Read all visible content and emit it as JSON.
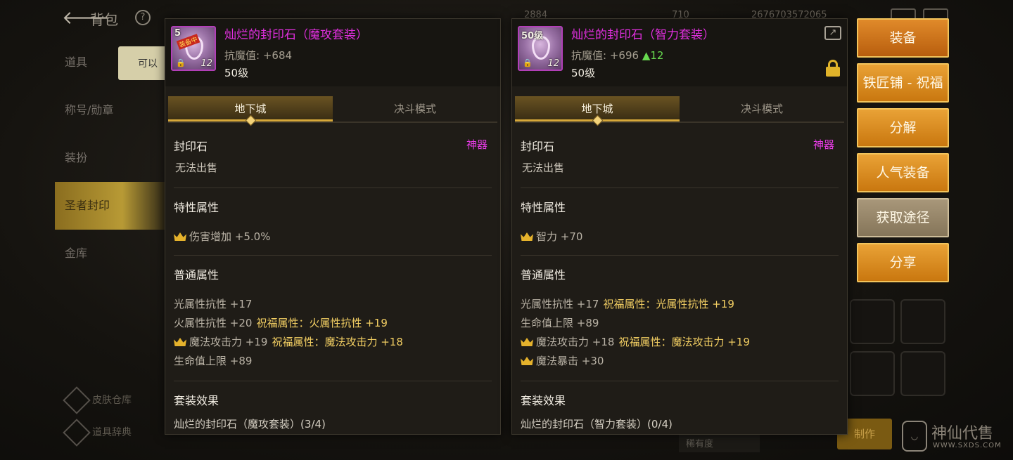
{
  "background": {
    "title": "背包",
    "nav": [
      "道具",
      "称号/勋章",
      "装扮",
      "圣者封印",
      "金库"
    ],
    "active_nav": "圣者封印",
    "tooltip": "可以",
    "bottom_links": [
      "皮肤仓库",
      "道具辞典"
    ],
    "craft_label": "制作",
    "select_value": "稀有度",
    "stats": [
      "2884",
      "710",
      "2676703572065"
    ]
  },
  "watermark": {
    "text": "神仙代售",
    "url": "WWW.SXDS.COM"
  },
  "left_panel": {
    "icon": {
      "level": "5",
      "qty": "12",
      "tag": "装备中"
    },
    "name": "灿烂的封印石（魔攻套装）",
    "stat_label": "抗魔值: ",
    "stat_value": "+684",
    "level": "50级",
    "tabs": [
      "地下城",
      "决斗模式"
    ],
    "category": "封印石",
    "type": "神器",
    "sell": "无法出售",
    "trait_title": "特性属性",
    "traits": [
      {
        "crown": true,
        "text": "伤害增加 +5.0%"
      }
    ],
    "normal_title": "普通属性",
    "normals": [
      {
        "crown": false,
        "text": "光属性抗性 +17",
        "bless": ""
      },
      {
        "crown": false,
        "text": "火属性抗性 +20",
        "bless": "祝福属性：火属性抗性 +19"
      },
      {
        "crown": true,
        "text": "魔法攻击力 +19",
        "bless": "祝福属性：魔法攻击力 +18"
      },
      {
        "crown": false,
        "text": "生命值上限 +89",
        "bless": ""
      }
    ],
    "set_title": "套装效果",
    "set_line": "灿烂的封印石（魔攻套装）(3/4)"
  },
  "right_panel": {
    "icon": {
      "level": "50级",
      "qty": "12"
    },
    "name": "灿烂的封印石（智力套装）",
    "stat_label": "抗魔值: ",
    "stat_value": "+696",
    "stat_delta": "▲12",
    "level": "50级",
    "tabs": [
      "地下城",
      "决斗模式"
    ],
    "category": "封印石",
    "type": "神器",
    "sell": "无法出售",
    "trait_title": "特性属性",
    "traits": [
      {
        "crown": true,
        "text": "智力 +70"
      }
    ],
    "normal_title": "普通属性",
    "normals": [
      {
        "crown": false,
        "text": "光属性抗性 +17",
        "bless": "祝福属性：光属性抗性 +19"
      },
      {
        "crown": false,
        "text": "生命值上限 +89",
        "bless": ""
      },
      {
        "crown": true,
        "text": "魔法攻击力 +18",
        "bless": "祝福属性：魔法攻击力 +19"
      },
      {
        "crown": true,
        "text": "魔法暴击 +30",
        "bless": ""
      }
    ],
    "set_title": "套装效果",
    "set_line": "灿烂的封印石（智力套装）(0/4)"
  },
  "actions": [
    "装备",
    "铁匠铺 - 祝福",
    "分解",
    "人气装备",
    "获取途径",
    "分享"
  ],
  "colors": {
    "accent": "#e9a236",
    "item_name": "#e22fe0",
    "bless": "#f3cf63",
    "stat_up": "#67d94f"
  }
}
